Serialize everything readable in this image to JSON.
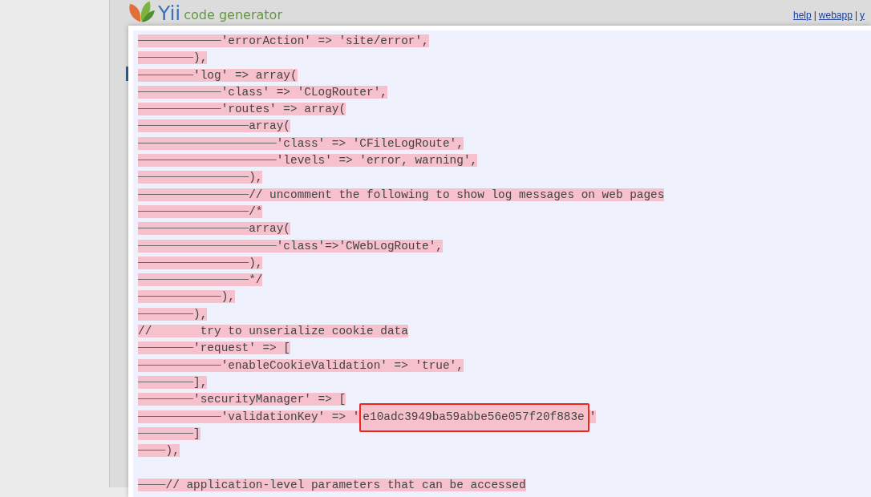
{
  "header": {
    "logo_text": "Yii",
    "subtitle": "code generator",
    "links": [
      "help",
      "webapp",
      "y"
    ],
    "separator": "|"
  },
  "code_lines": [
    {
      "kind": "removed",
      "text": "            'errorAction' => 'site/error',"
    },
    {
      "kind": "removed",
      "text": "        ),"
    },
    {
      "kind": "removed",
      "text": "        'log' => array("
    },
    {
      "kind": "removed",
      "text": "            'class' => 'CLogRouter',"
    },
    {
      "kind": "removed",
      "text": "            'routes' => array("
    },
    {
      "kind": "removed",
      "text": "                array("
    },
    {
      "kind": "removed",
      "text": "                    'class' => 'CFileLogRoute',"
    },
    {
      "kind": "removed",
      "text": "                    'levels' => 'error, warning',"
    },
    {
      "kind": "removed",
      "text": "                ),"
    },
    {
      "kind": "removed",
      "text": "                // uncomment the following to show log messages on web pages"
    },
    {
      "kind": "removed",
      "text": "                /*"
    },
    {
      "kind": "removed",
      "text": "                array("
    },
    {
      "kind": "removed",
      "text": "                    'class'=>'CWebLogRoute',"
    },
    {
      "kind": "removed",
      "text": "                ),"
    },
    {
      "kind": "removed",
      "text": "                */"
    },
    {
      "kind": "removed",
      "text": "            ),"
    },
    {
      "kind": "removed",
      "text": "        ),"
    },
    {
      "kind": "removed",
      "text": "//       try to unserialize cookie data"
    },
    {
      "kind": "removed",
      "text": "        'request' => ["
    },
    {
      "kind": "removed",
      "text": "            'enableCookieValidation' => 'true',"
    },
    {
      "kind": "removed",
      "text": "        ],"
    },
    {
      "kind": "removed",
      "text": "        'securityManager' => ["
    },
    {
      "kind": "removed",
      "text": "            'validationKey' => '",
      "highlighted": "e10adc3949ba59abbe56e057f20f883e",
      "after": "'"
    },
    {
      "kind": "removed",
      "text": "        ]"
    },
    {
      "kind": "removed",
      "text": "    ),"
    },
    {
      "kind": "blank"
    },
    {
      "kind": "removed",
      "text": "    // application-level parameters that can be accessed"
    }
  ]
}
